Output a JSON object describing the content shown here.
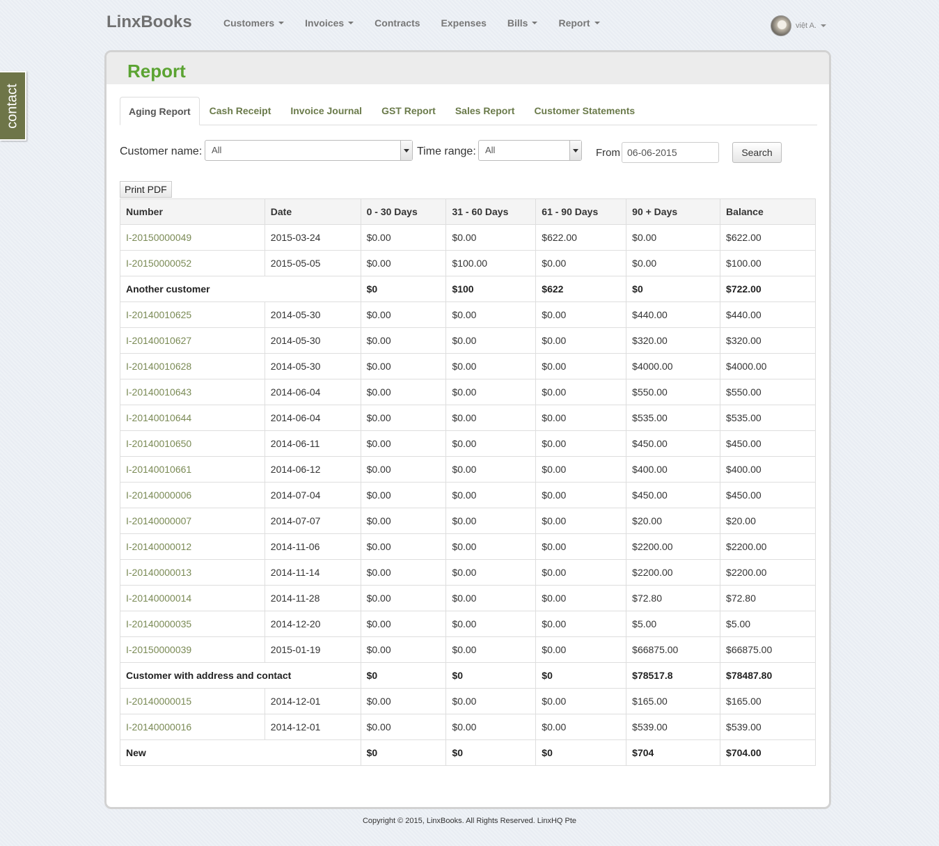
{
  "navbar": {
    "brand": "LinxBooks",
    "items": [
      {
        "label": "Customers",
        "dropdown": true
      },
      {
        "label": "Invoices",
        "dropdown": true
      },
      {
        "label": "Contracts",
        "dropdown": false
      },
      {
        "label": "Expenses",
        "dropdown": false
      },
      {
        "label": "Bills",
        "dropdown": true
      },
      {
        "label": "Report",
        "dropdown": true
      }
    ],
    "user_name": "việt A."
  },
  "contact_tab": "contact",
  "page_title": "Report",
  "tabs": [
    "Aging Report",
    "Cash Receipt",
    "Invoice Journal",
    "GST Report",
    "Sales Report",
    "Customer Statements"
  ],
  "active_tab": "Aging Report",
  "filters": {
    "customer_label": "Customer name:",
    "customer_value": "All",
    "time_label": "Time range:",
    "time_value": "All",
    "from_label": "From",
    "from_value": "06-06-2015",
    "search_label": "Search"
  },
  "print_label": "Print PDF",
  "table": {
    "headers": [
      "Number",
      "Date",
      "0 - 30 Days",
      "31 - 60 Days",
      "61 - 90 Days",
      "90 + Days",
      "Balance"
    ],
    "rows": [
      {
        "type": "row",
        "cells": [
          "I-20150000049",
          "2015-03-24",
          "$0.00",
          "$0.00",
          "$622.00",
          "$0.00",
          "$622.00"
        ]
      },
      {
        "type": "row",
        "cells": [
          "I-20150000052",
          "2015-05-05",
          "$0.00",
          "$100.00",
          "$0.00",
          "$0.00",
          "$100.00"
        ]
      },
      {
        "type": "total",
        "cells": [
          "Another customer",
          "$0",
          "$100",
          "$622",
          "$0",
          "$722.00"
        ]
      },
      {
        "type": "row",
        "cells": [
          "I-20140010625",
          "2014-05-30",
          "$0.00",
          "$0.00",
          "$0.00",
          "$440.00",
          "$440.00"
        ]
      },
      {
        "type": "row",
        "cells": [
          "I-20140010627",
          "2014-05-30",
          "$0.00",
          "$0.00",
          "$0.00",
          "$320.00",
          "$320.00"
        ]
      },
      {
        "type": "row",
        "cells": [
          "I-20140010628",
          "2014-05-30",
          "$0.00",
          "$0.00",
          "$0.00",
          "$4000.00",
          "$4000.00"
        ]
      },
      {
        "type": "row",
        "cells": [
          "I-20140010643",
          "2014-06-04",
          "$0.00",
          "$0.00",
          "$0.00",
          "$550.00",
          "$550.00"
        ]
      },
      {
        "type": "row",
        "cells": [
          "I-20140010644",
          "2014-06-04",
          "$0.00",
          "$0.00",
          "$0.00",
          "$535.00",
          "$535.00"
        ]
      },
      {
        "type": "row",
        "cells": [
          "I-20140010650",
          "2014-06-11",
          "$0.00",
          "$0.00",
          "$0.00",
          "$450.00",
          "$450.00"
        ]
      },
      {
        "type": "row",
        "cells": [
          "I-20140010661",
          "2014-06-12",
          "$0.00",
          "$0.00",
          "$0.00",
          "$400.00",
          "$400.00"
        ]
      },
      {
        "type": "row",
        "cells": [
          "I-20140000006",
          "2014-07-04",
          "$0.00",
          "$0.00",
          "$0.00",
          "$450.00",
          "$450.00"
        ]
      },
      {
        "type": "row",
        "cells": [
          "I-20140000007",
          "2014-07-07",
          "$0.00",
          "$0.00",
          "$0.00",
          "$20.00",
          "$20.00"
        ]
      },
      {
        "type": "row",
        "cells": [
          "I-20140000012",
          "2014-11-06",
          "$0.00",
          "$0.00",
          "$0.00",
          "$2200.00",
          "$2200.00"
        ]
      },
      {
        "type": "row",
        "cells": [
          "I-20140000013",
          "2014-11-14",
          "$0.00",
          "$0.00",
          "$0.00",
          "$2200.00",
          "$2200.00"
        ]
      },
      {
        "type": "row",
        "cells": [
          "I-20140000014",
          "2014-11-28",
          "$0.00",
          "$0.00",
          "$0.00",
          "$72.80",
          "$72.80"
        ]
      },
      {
        "type": "row",
        "cells": [
          "I-20140000035",
          "2014-12-20",
          "$0.00",
          "$0.00",
          "$0.00",
          "$5.00",
          "$5.00"
        ]
      },
      {
        "type": "row",
        "cells": [
          "I-20150000039",
          "2015-01-19",
          "$0.00",
          "$0.00",
          "$0.00",
          "$66875.00",
          "$66875.00"
        ]
      },
      {
        "type": "total",
        "cells": [
          "Customer with address and contact",
          "$0",
          "$0",
          "$0",
          "$78517.8",
          "$78487.80"
        ]
      },
      {
        "type": "row",
        "cells": [
          "I-20140000015",
          "2014-12-01",
          "$0.00",
          "$0.00",
          "$0.00",
          "$165.00",
          "$165.00"
        ]
      },
      {
        "type": "row",
        "cells": [
          "I-20140000016",
          "2014-12-01",
          "$0.00",
          "$0.00",
          "$0.00",
          "$539.00",
          "$539.00"
        ]
      },
      {
        "type": "total",
        "cells": [
          "New",
          "$0",
          "$0",
          "$0",
          "$704",
          "$704.00"
        ]
      }
    ]
  },
  "footer": "Copyright © 2015, LinxBooks. All Rights Reserved. LinxHQ Pte"
}
